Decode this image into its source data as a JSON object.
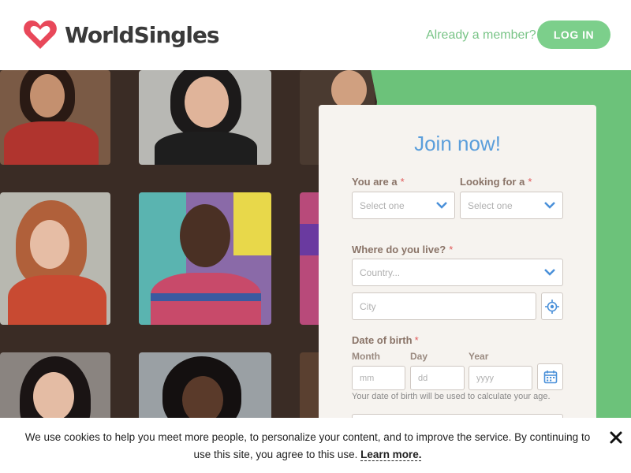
{
  "header": {
    "logo_text": "WorldSingles",
    "already_member": "Already a member?",
    "login_label": "LOG IN"
  },
  "form": {
    "title": "Join now!",
    "you_are_label": "You are a",
    "looking_for_label": "Looking for a",
    "required_mark": "*",
    "select_placeholder": "Select one",
    "where_label": "Where do you live?",
    "country_placeholder": "Country...",
    "city_placeholder": "City",
    "dob_label": "Date of birth",
    "month_label": "Month",
    "day_label": "Day",
    "year_label": "Year",
    "month_placeholder": "mm",
    "day_placeholder": "dd",
    "year_placeholder": "yyyy",
    "dob_hint": "Your date of birth will be used to calculate your age."
  },
  "cookie": {
    "text": "We use cookies to help you meet more people, to personalize your content, and to improve the service. By continuing to use this site, you agree to this use.",
    "learn_more": "Learn more."
  },
  "colors": {
    "brand_green": "#7ccf8b",
    "title_blue": "#5a9edb",
    "logo_red": "#e8485a"
  },
  "icons": [
    "heart-logo-icon",
    "chevron-down-icon",
    "location-target-icon",
    "calendar-icon",
    "close-icon"
  ]
}
